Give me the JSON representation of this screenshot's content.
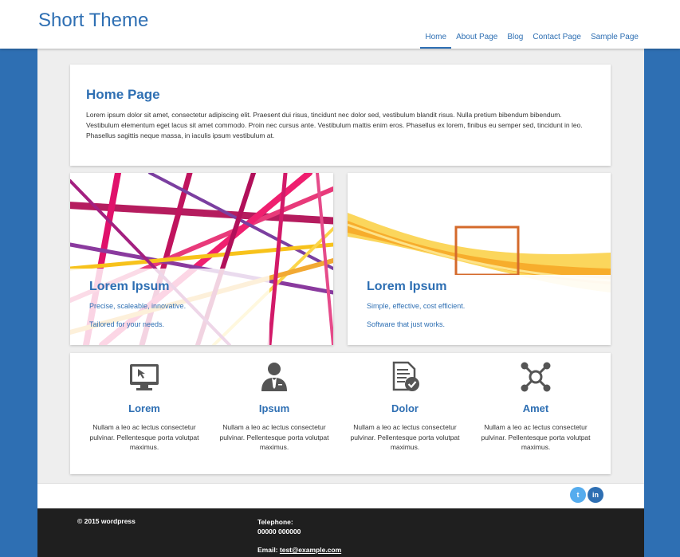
{
  "header": {
    "site_title": "Short Theme",
    "nav": [
      "Home",
      "About Page",
      "Blog",
      "Contact Page",
      "Sample Page"
    ],
    "active_nav": "Home"
  },
  "intro": {
    "title": "Home Page",
    "body": "Lorem ipsum dolor sit amet, consectetur adipiscing elit. Praesent dui risus, tincidunt nec dolor sed, vestibulum blandit risus. Nulla pretium bibendum bibendum. Vestibulum elementum eget lacus sit amet commodo. Proin nec cursus ante. Vestibulum mattis enim eros. Phasellus ex lorem, finibus eu semper sed, tincidunt in leo. Phasellus sagittis neque massa, in iaculis ipsum vestibulum at."
  },
  "features": [
    {
      "title": "Lorem Ipsum",
      "line1": "Precise, scaleable, innovative.",
      "line2": "Tailored for your needs."
    },
    {
      "title": "Lorem Ipsum",
      "line1": "Simple, effective, cost efficient.",
      "line2": "Software that just works."
    }
  ],
  "services": [
    {
      "icon": "monitor-icon",
      "title": "Lorem",
      "text": "Nullam a leo ac lectus consectetur pulvinar. Pellentesque porta volutpat maximus."
    },
    {
      "icon": "user-tie-icon",
      "title": "Ipsum",
      "text": "Nullam a leo ac lectus consectetur pulvinar. Pellentesque porta volutpat maximus."
    },
    {
      "icon": "document-check-icon",
      "title": "Dolor",
      "text": "Nullam a leo ac lectus consectetur pulvinar. Pellentesque porta volutpat maximus."
    },
    {
      "icon": "network-icon",
      "title": "Amet",
      "text": "Nullam a leo ac lectus consectetur pulvinar. Pellentesque porta volutpat maximus."
    }
  ],
  "social": {
    "twitter_glyph": "t",
    "linkedin_glyph": "in"
  },
  "footer": {
    "copyright": "© 2015 wordpress",
    "telephone_label": "Telephone:",
    "telephone": "00000 000000",
    "email_label": "Email:",
    "email": "test@example.com"
  },
  "colors": {
    "accent": "#2e6fb3",
    "footer_bg": "#1f1f1f",
    "content_bg": "#eeeeee"
  }
}
